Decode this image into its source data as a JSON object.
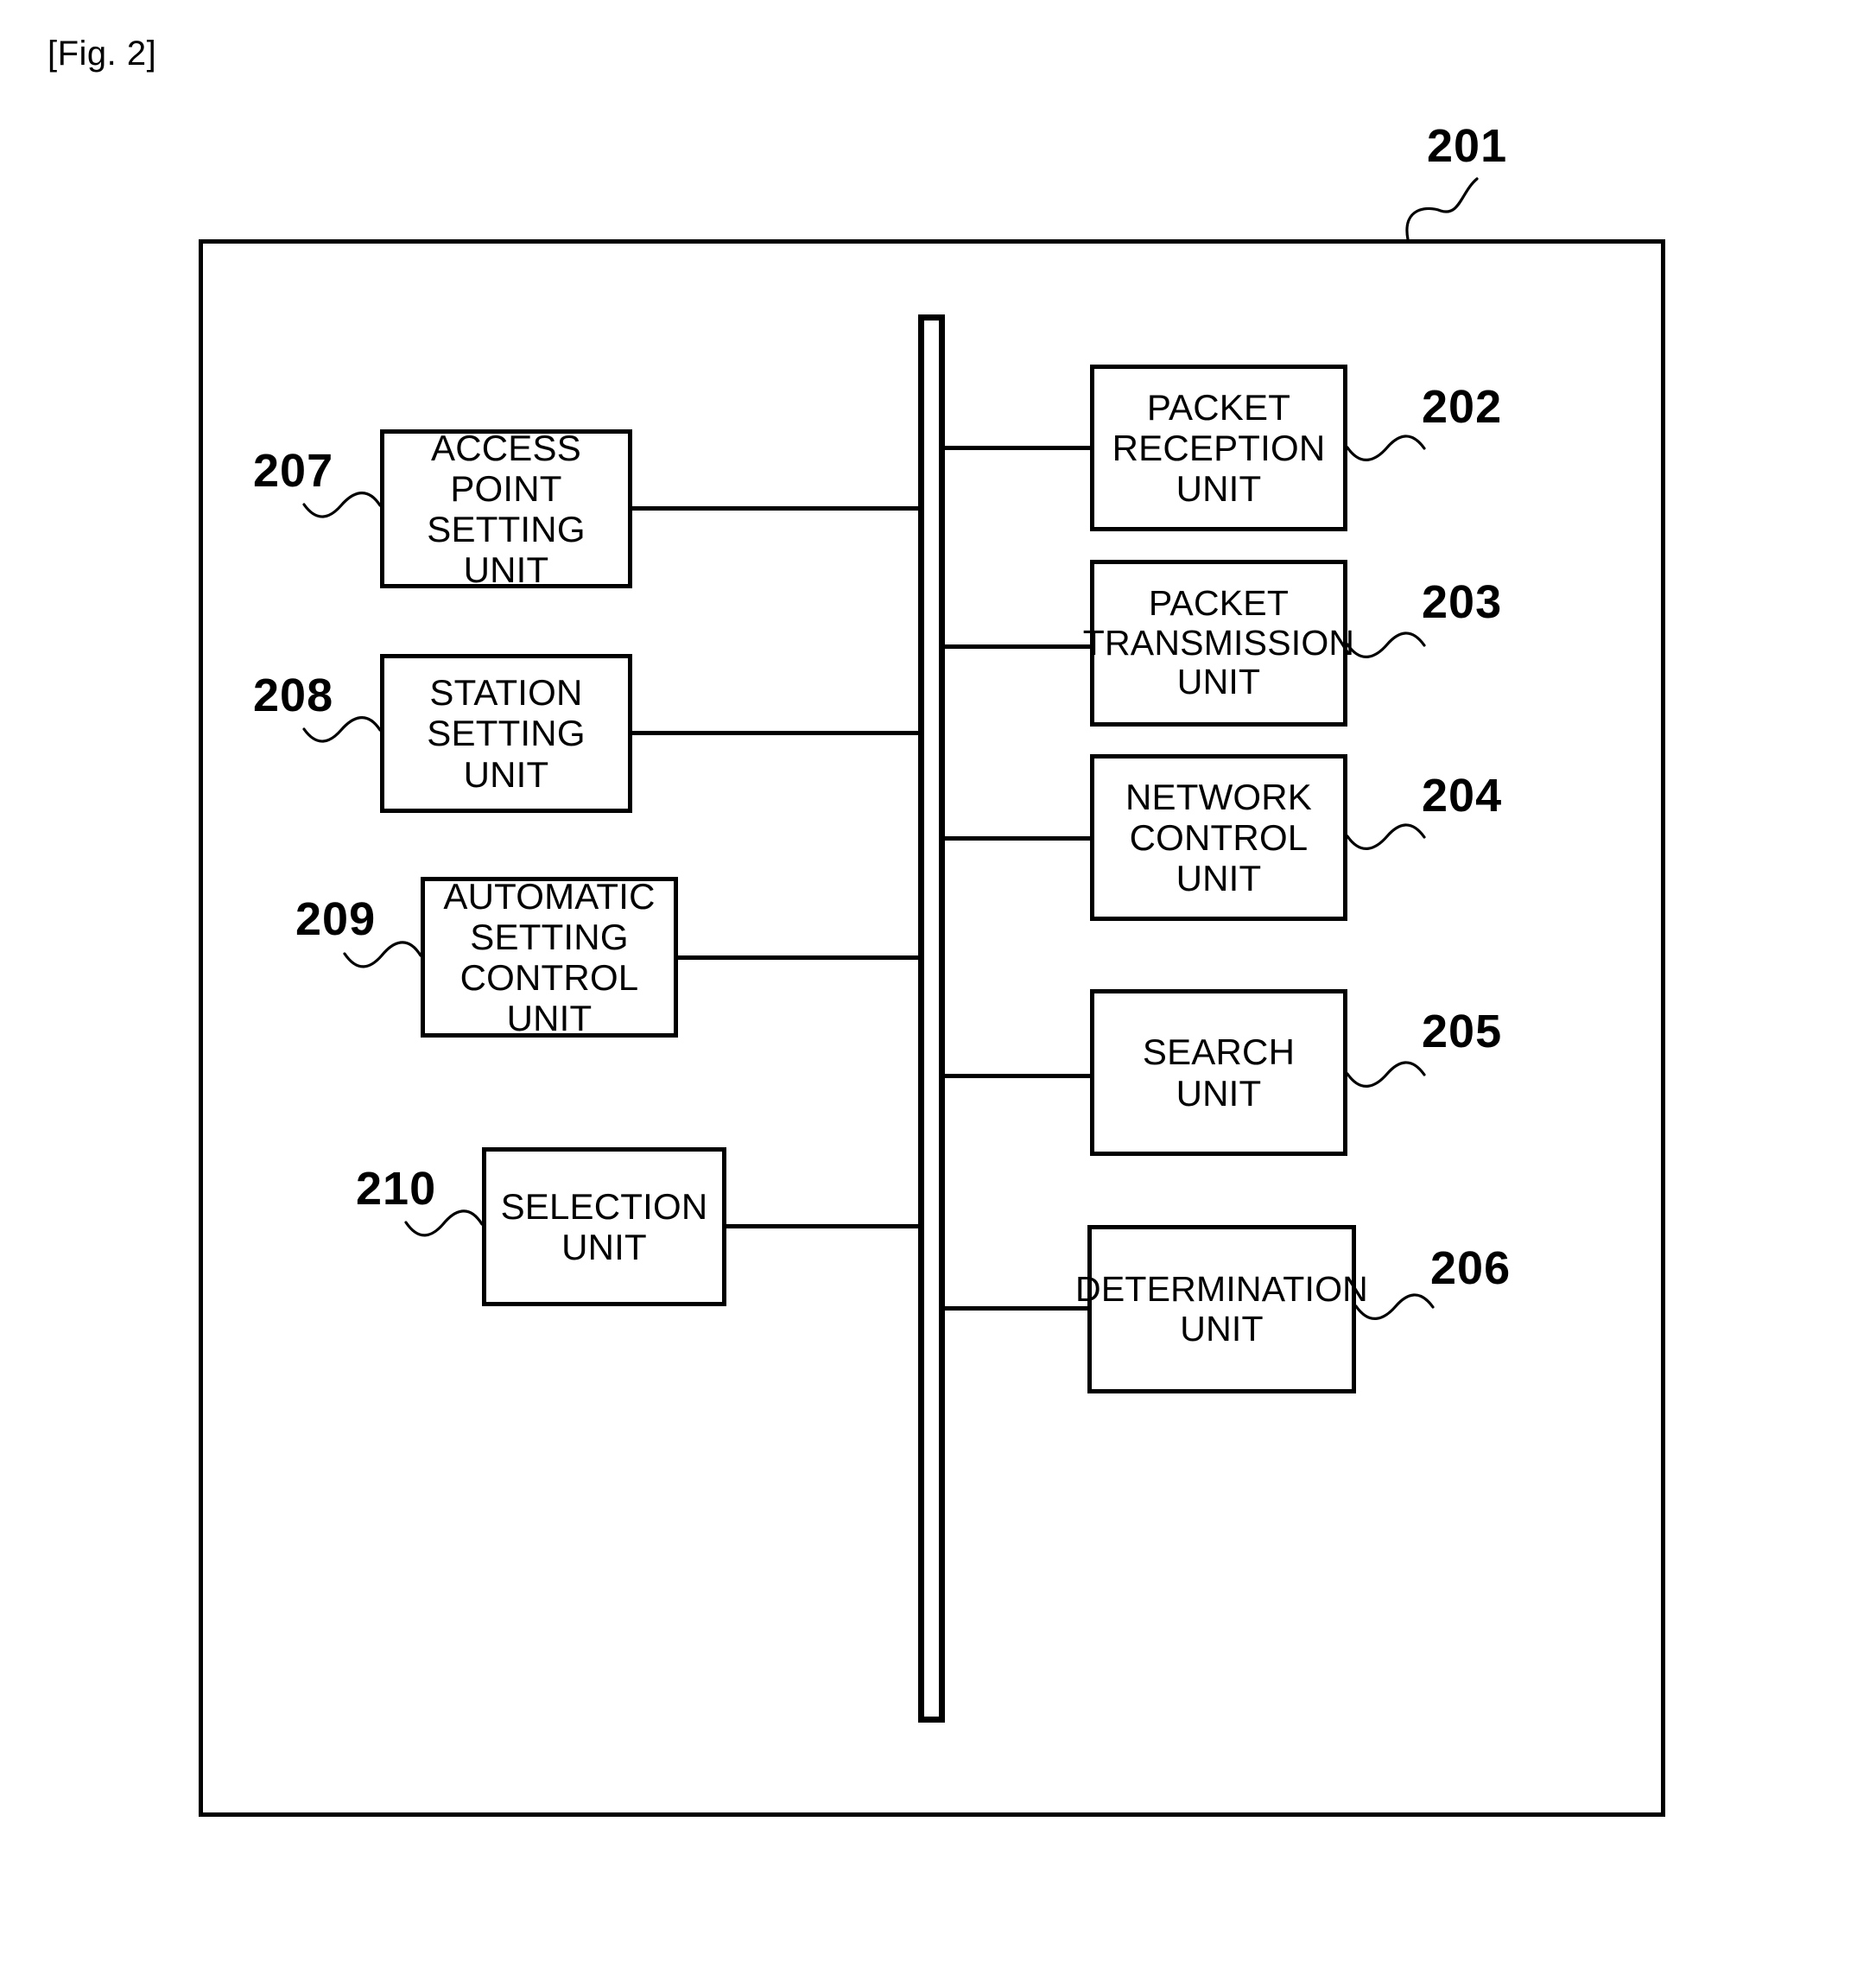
{
  "figure": {
    "label": "[Fig. 2]",
    "apparatus_ref": "201"
  },
  "bus": {
    "name": "internal-bus"
  },
  "left_units": [
    {
      "ref": "207",
      "label": "ACCESS POINT\nSETTING UNIT",
      "name": "access-point-setting-unit"
    },
    {
      "ref": "208",
      "label": "STATION\nSETTING UNIT",
      "name": "station-setting-unit"
    },
    {
      "ref": "209",
      "label": "AUTOMATIC\nSETTING\nCONTROL UNIT",
      "name": "automatic-setting-control-unit"
    },
    {
      "ref": "210",
      "label": "SELECTION\nUNIT",
      "name": "selection-unit"
    }
  ],
  "right_units": [
    {
      "ref": "202",
      "label": "PACKET\nRECEPTION\nUNIT",
      "name": "packet-reception-unit"
    },
    {
      "ref": "203",
      "label": "PACKET\nTRANSMISSION\nUNIT",
      "name": "packet-transmission-unit"
    },
    {
      "ref": "204",
      "label": "NETWORK\nCONTROL\nUNIT",
      "name": "network-control-unit"
    },
    {
      "ref": "205",
      "label": "SEARCH\nUNIT",
      "name": "search-unit"
    },
    {
      "ref": "206",
      "label": "DETERMINATION\nUNIT",
      "name": "determination-unit"
    }
  ],
  "colors": {
    "line": "#000000",
    "background": "#ffffff"
  }
}
